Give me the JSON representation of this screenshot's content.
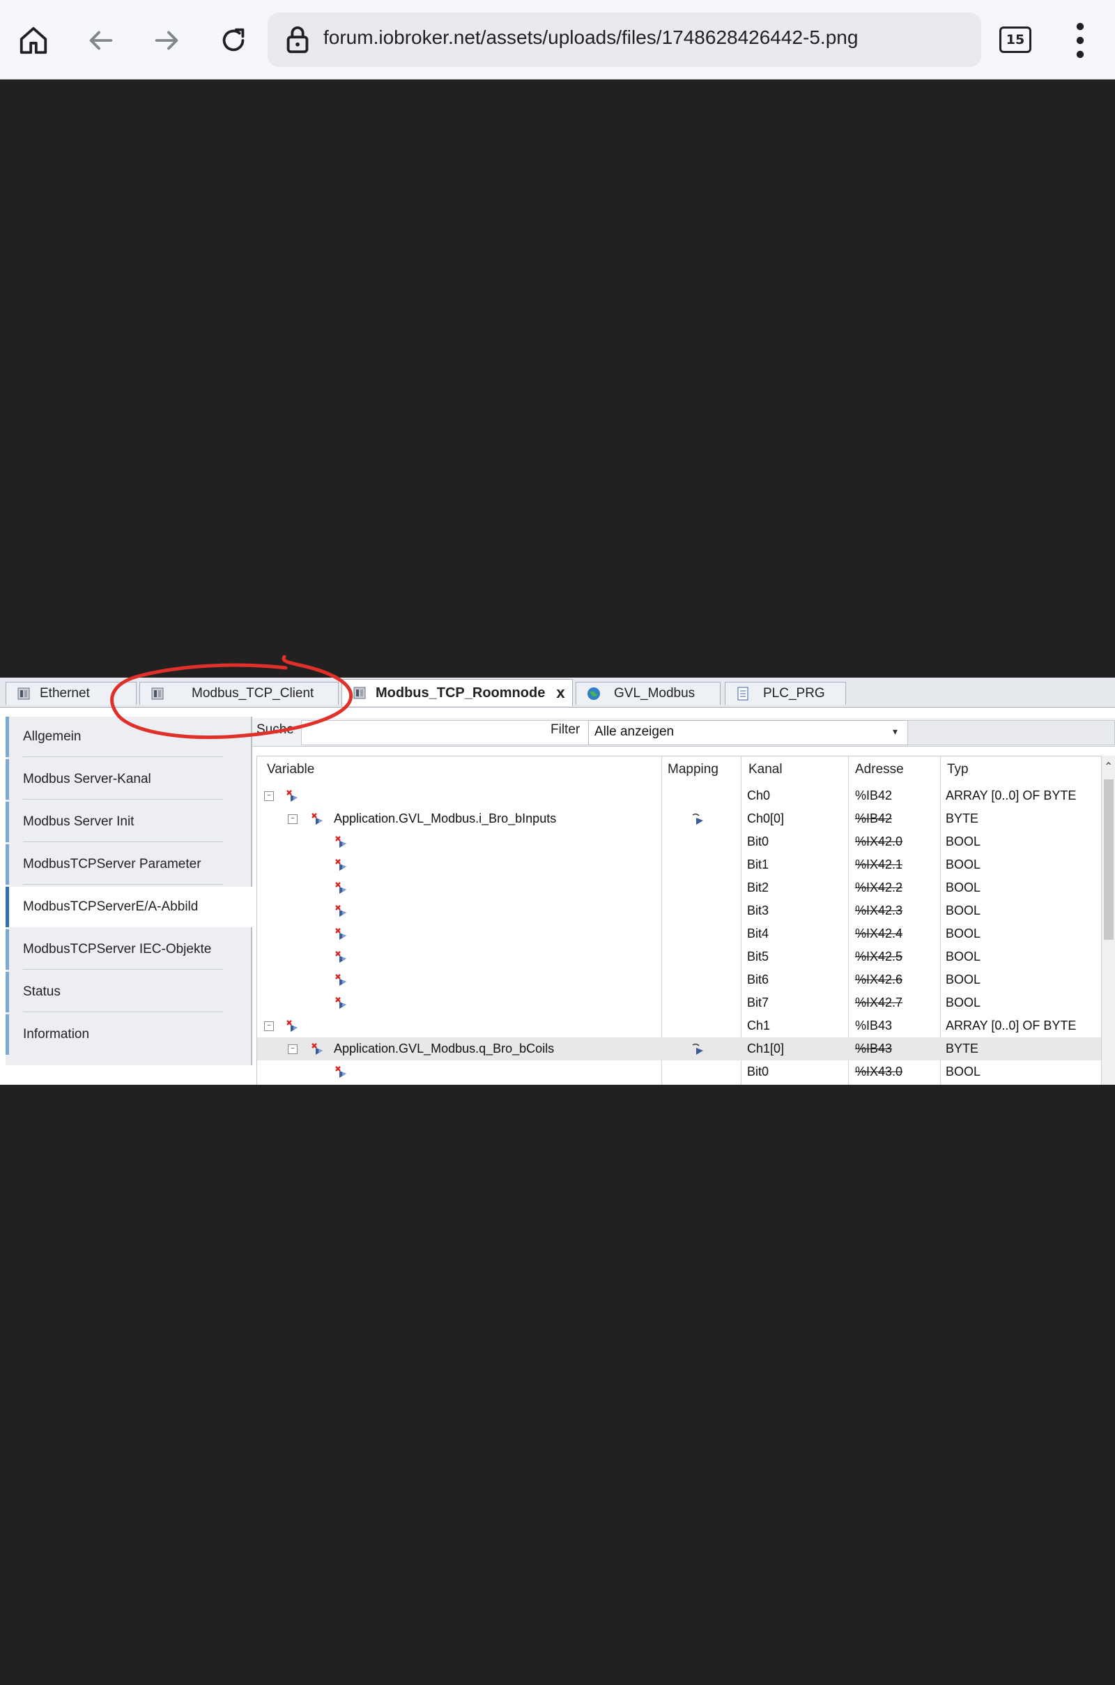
{
  "browser": {
    "url": "forum.iobroker.net/assets/uploads/files/1748628426442-5.png",
    "tab_count": "15"
  },
  "ide": {
    "tabs": [
      {
        "label": "Ethernet"
      },
      {
        "label": "Modbus_TCP_Client"
      },
      {
        "label": "Modbus_TCP_Roomnode",
        "close": "x"
      },
      {
        "label": "GVL_Modbus"
      },
      {
        "label": "PLC_PRG"
      }
    ],
    "sidebar": [
      {
        "label": "Allgemein"
      },
      {
        "label": "Modbus Server-Kanal"
      },
      {
        "label": "Modbus Server Init"
      },
      {
        "label": "ModbusTCPServer Parameter"
      },
      {
        "label": "ModbusTCPServerE/A-Abbild"
      },
      {
        "label": "ModbusTCPServer IEC-Objekte"
      },
      {
        "label": "Status"
      },
      {
        "label": "Information"
      }
    ],
    "search_label": "Suche",
    "filter_label": "Filter",
    "filter_value": "Alle anzeigen",
    "columns": {
      "variable": "Variable",
      "mapping": "Mapping",
      "kanal": "Kanal",
      "adresse": "Adresse",
      "typ": "Typ"
    },
    "rows": [
      {
        "variable": "",
        "kanal": "Ch0",
        "adresse": "%IB42",
        "typ": "ARRAY [0..0] OF BYTE"
      },
      {
        "variable": "Application.GVL_Modbus.i_Bro_bInputs",
        "kanal": "Ch0[0]",
        "adresse": "%IB42",
        "typ": "BYTE"
      },
      {
        "variable": "",
        "kanal": "Bit0",
        "adresse": "%IX42.0",
        "typ": "BOOL"
      },
      {
        "variable": "",
        "kanal": "Bit1",
        "adresse": "%IX42.1",
        "typ": "BOOL"
      },
      {
        "variable": "",
        "kanal": "Bit2",
        "adresse": "%IX42.2",
        "typ": "BOOL"
      },
      {
        "variable": "",
        "kanal": "Bit3",
        "adresse": "%IX42.3",
        "typ": "BOOL"
      },
      {
        "variable": "",
        "kanal": "Bit4",
        "adresse": "%IX42.4",
        "typ": "BOOL"
      },
      {
        "variable": "",
        "kanal": "Bit5",
        "adresse": "%IX42.5",
        "typ": "BOOL"
      },
      {
        "variable": "",
        "kanal": "Bit6",
        "adresse": "%IX42.6",
        "typ": "BOOL"
      },
      {
        "variable": "",
        "kanal": "Bit7",
        "adresse": "%IX42.7",
        "typ": "BOOL"
      },
      {
        "variable": "",
        "kanal": "Ch1",
        "adresse": "%IB43",
        "typ": "ARRAY [0..0] OF BYTE"
      },
      {
        "variable": "Application.GVL_Modbus.q_Bro_bCoils",
        "kanal": "Ch1[0]",
        "adresse": "%IB43",
        "typ": "BYTE"
      },
      {
        "variable": "",
        "kanal": "Bit0",
        "adresse": "%IX43.0",
        "typ": "BOOL"
      }
    ]
  },
  "colors": {
    "page_background": "#212121",
    "annotation": "#e0302a",
    "sidebar_accent": "#7aa9d6"
  }
}
